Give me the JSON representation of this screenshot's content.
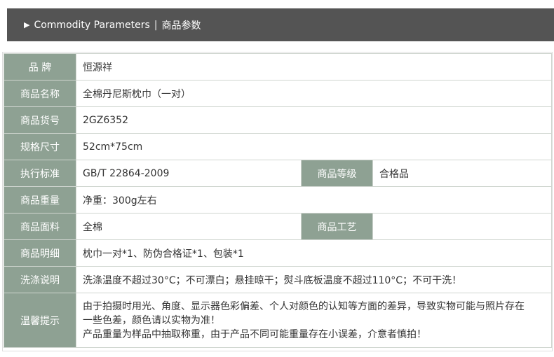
{
  "header": {
    "title_en": "Commodity Parameters",
    "separator": "|",
    "title_cn": "商品参数"
  },
  "rows": {
    "brand": {
      "label": "品 牌",
      "value": "恒源祥"
    },
    "name": {
      "label": "商品名称",
      "value": "全棉丹尼斯枕巾（一对）"
    },
    "sku": {
      "label": "商品货号",
      "value": "2GZ6352"
    },
    "size": {
      "label": "规格尺寸",
      "value": "52cm*75cm"
    },
    "standard": {
      "label": "执行标准",
      "value": "GB/T 22864-2009",
      "label2": "商品等级",
      "value2": "合格品"
    },
    "weight": {
      "label": "商品重量",
      "value": "净重：300g左右"
    },
    "fabric": {
      "label": "商品面料",
      "value": "全棉",
      "label2": "商品工艺",
      "value2": ""
    },
    "contents": {
      "label": "商品明细",
      "value": "枕巾一对*1、防伪合格证*1、包装*1"
    },
    "washing": {
      "label": "洗涤说明",
      "value": "洗涤温度不超过30°C；不可漂白；悬挂晾干；熨斗底板温度不超过110°C；不可干洗！"
    },
    "notice": {
      "label": "温馨提示",
      "line1": "由于拍摄时用光、角度、显示器色彩偏差、个人对颜色的认知等方面的差异，导致实物可能与照片存在",
      "line2": "一些色差，颜色请以实物为准！",
      "line3": "产品重量为样品中抽取称重，由于产品不同可能重量存在小误差，介意者慎拍！"
    }
  },
  "colors": {
    "header_bg": "#545454",
    "label_bg": "#8ea193",
    "border": "#cfd5cf"
  }
}
